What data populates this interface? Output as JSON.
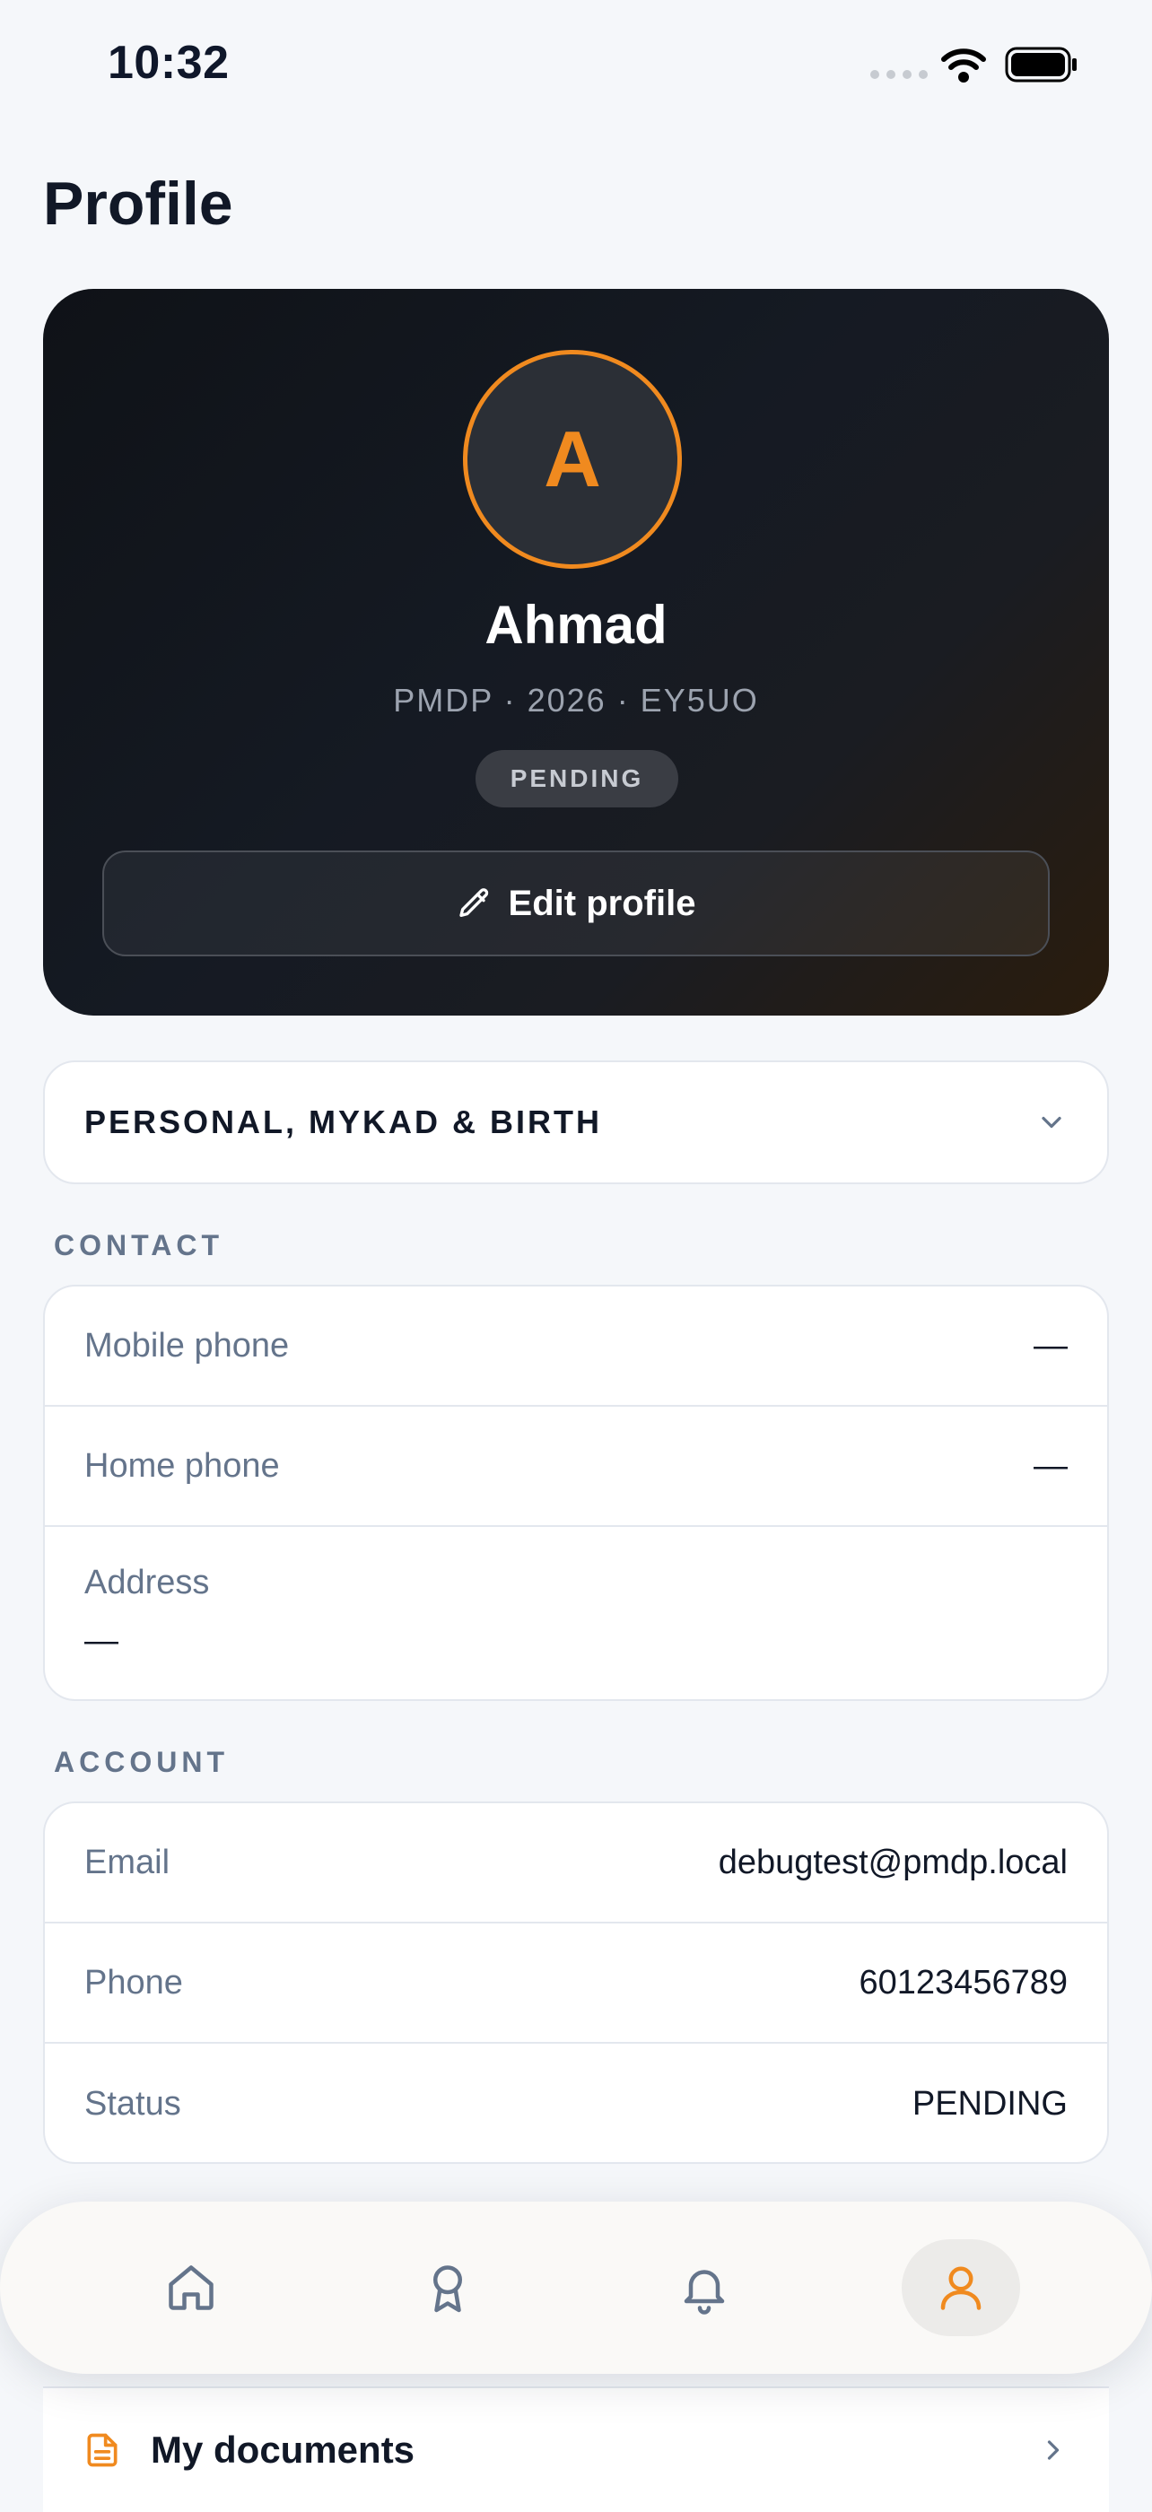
{
  "status_bar": {
    "time": "10:32",
    "icons": [
      "signal-icon",
      "wifi-icon",
      "battery-icon"
    ]
  },
  "page": {
    "title": "Profile"
  },
  "profile": {
    "avatar_initial": "A",
    "name": "Ahmad",
    "subtitle": "PMDP · 2026 · EY5UO",
    "status_badge": "PENDING",
    "edit_button": "Edit profile"
  },
  "accordion": {
    "title": "PERSONAL, MYKAD & BIRTH"
  },
  "contact": {
    "heading": "CONTACT",
    "rows": [
      {
        "label": "Mobile phone",
        "value": "—"
      },
      {
        "label": "Home phone",
        "value": "—"
      },
      {
        "label": "Address",
        "value": "—"
      }
    ]
  },
  "account": {
    "heading": "ACCOUNT",
    "rows": [
      {
        "label": "Email",
        "value": "debugtest@pmdp.local"
      },
      {
        "label": "Phone",
        "value": "60123456789"
      },
      {
        "label": "Status",
        "value": "PENDING"
      }
    ]
  },
  "documents": {
    "label": "My documents"
  },
  "bottom_nav": {
    "items": [
      {
        "icon": "home-icon",
        "active": false
      },
      {
        "icon": "award-icon",
        "active": false
      },
      {
        "icon": "bell-icon",
        "active": false
      },
      {
        "icon": "user-icon",
        "active": true
      }
    ]
  },
  "colors": {
    "accent": "#f08a1f",
    "muted": "#64748b",
    "background": "#f5f7fa"
  }
}
